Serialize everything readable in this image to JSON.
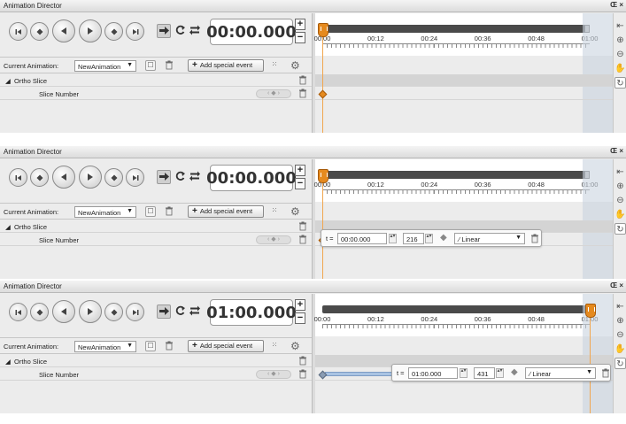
{
  "window": {
    "title": "Animation Director",
    "controls": "Œ ×"
  },
  "transport": {
    "buttons": [
      "go-to-start",
      "prev-keyframe",
      "play-backward",
      "play-forward",
      "next-keyframe",
      "go-to-end"
    ],
    "modes": [
      "play-once",
      "loop",
      "ping-pong"
    ]
  },
  "animation_bar": {
    "current_label": "Current Animation:",
    "current_value": "NewAnimation",
    "add_event_label": "Add special event"
  },
  "tracks": {
    "group_label": "Ortho Slice",
    "item_label": "Slice Number"
  },
  "ruler": {
    "labels": [
      "00:00",
      "00:12",
      "00:24",
      "00:36",
      "00:48",
      "01:00"
    ]
  },
  "panels": [
    {
      "time": "00:00.000",
      "playhead_fraction": 0.0,
      "popup": null,
      "keyframes": [
        0.0
      ]
    },
    {
      "time": "00:00.000",
      "playhead_fraction": 0.0,
      "popup": {
        "t_label": "t =",
        "t_value": "00:00.000",
        "slice_value": "216",
        "interp": "Linear"
      },
      "keyframes": [
        0.0
      ]
    },
    {
      "time": "01:00.000",
      "playhead_fraction": 1.0,
      "popup": {
        "t_label": "t =",
        "t_value": "01:00.000",
        "slice_value": "431",
        "interp": "Linear"
      },
      "keyframes": [
        0.0,
        1.0
      ]
    }
  ],
  "colors": {
    "accent": "#e58a1f",
    "keyframe_bar": "#a9c3e3",
    "shade": "#c9d3e0"
  }
}
